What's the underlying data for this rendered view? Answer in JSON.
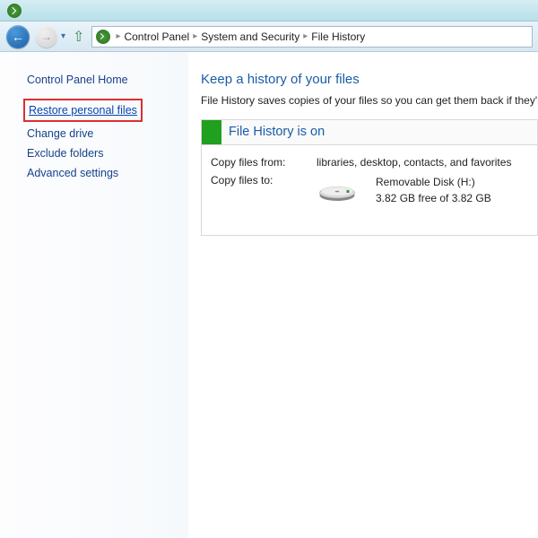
{
  "breadcrumb": {
    "items": [
      "Control Panel",
      "System and Security",
      "File History"
    ]
  },
  "sidebar": {
    "home": "Control Panel Home",
    "links": [
      "Restore personal files",
      "Change drive",
      "Exclude folders",
      "Advanced settings"
    ]
  },
  "main": {
    "title": "Keep a history of your files",
    "subtitle": "File History saves copies of your files so you can get them back if they're",
    "status_title": "File History is on",
    "copy_from_label": "Copy files from:",
    "copy_from_value": "libraries, desktop, contacts, and favorites",
    "copy_to_label": "Copy files to:",
    "disk_name": "Removable Disk (H:)",
    "disk_free": "3.82 GB free of 3.82 GB"
  }
}
